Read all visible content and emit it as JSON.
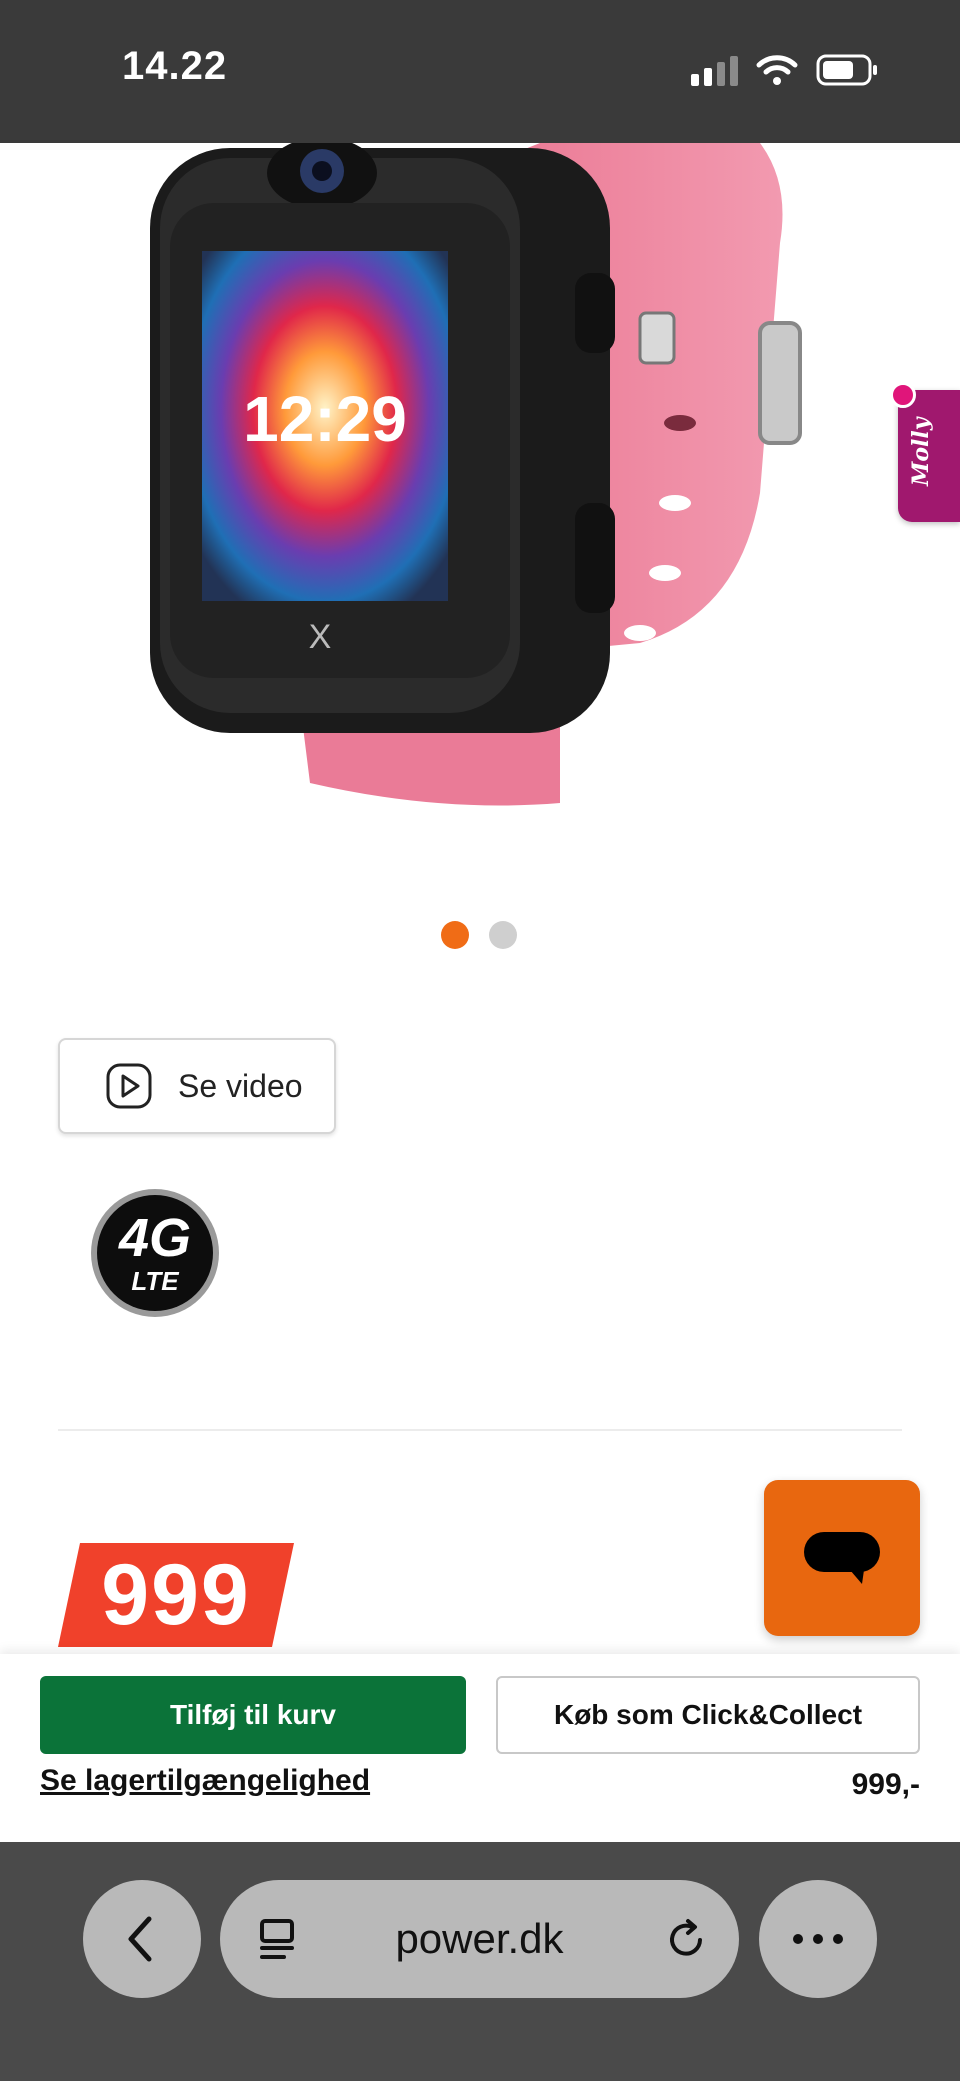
{
  "status_bar": {
    "time": "14.22"
  },
  "product": {
    "watch_time": "12:29",
    "video_button_label": "Se video",
    "badge_4g": "4G",
    "badge_lte": "LTE",
    "price_big": "999",
    "price_small": "999,-",
    "carousel": {
      "count": 2,
      "active_index": 0
    }
  },
  "side_tab": {
    "label": "Molly"
  },
  "actions": {
    "add_to_cart": "Tilføj til kurv",
    "click_collect": "Køb som Click&Collect",
    "stock_link": "Se lagertilgængelighed"
  },
  "browser": {
    "url": "power.dk"
  },
  "colors": {
    "accent_orange": "#f06c16",
    "cart_green": "#0b7339",
    "price_red": "#f0412b",
    "side_tab_purple": "#a0186e"
  },
  "icons": [
    "signal-icon",
    "wifi-icon",
    "battery-icon",
    "play-icon",
    "chat-icon",
    "back-icon",
    "reader-icon",
    "reload-icon",
    "more-icon"
  ]
}
